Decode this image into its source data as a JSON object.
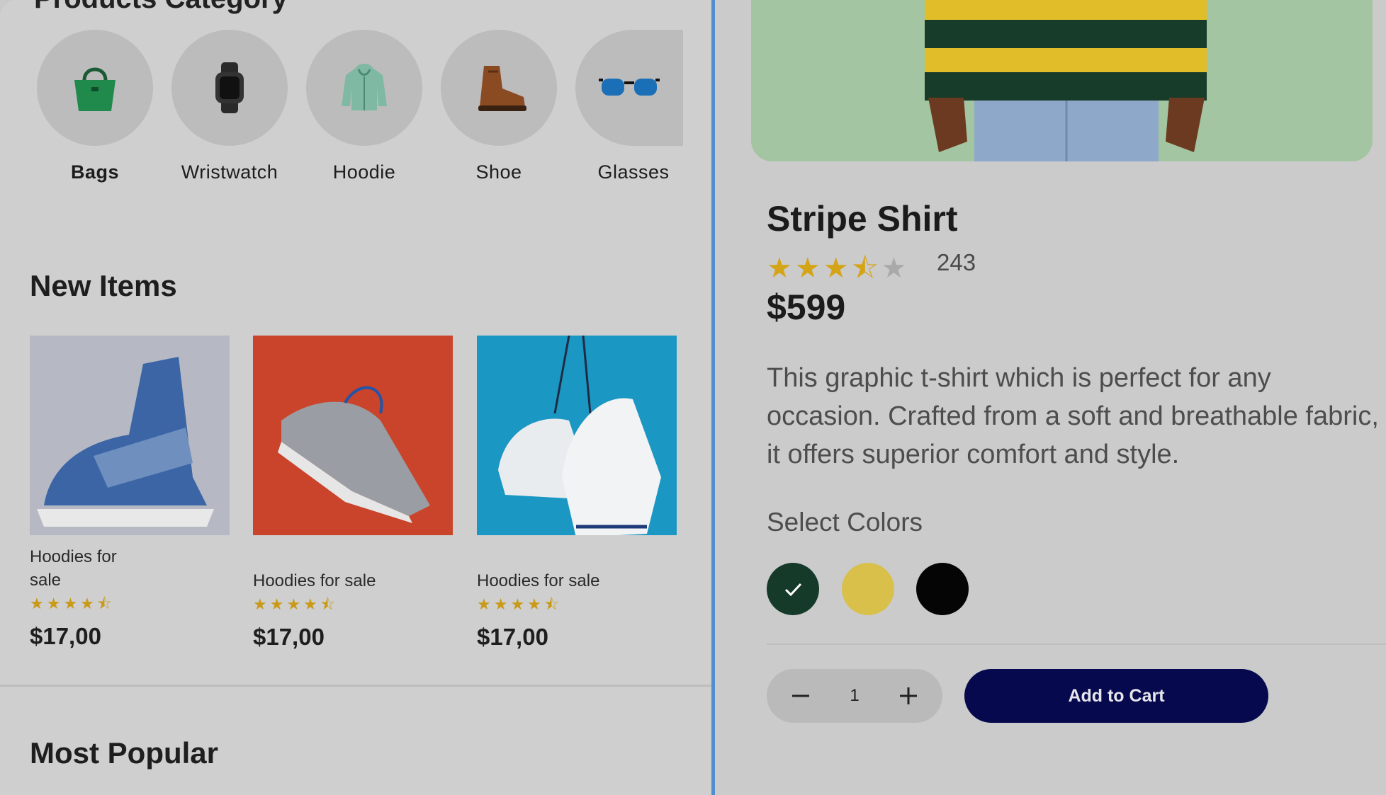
{
  "left": {
    "category_title": "Products Category",
    "categories": [
      {
        "label": "Bags",
        "icon": "handbag-icon"
      },
      {
        "label": "Wristwatch",
        "icon": "smartwatch-icon"
      },
      {
        "label": "Hoodie",
        "icon": "hoodie-icon"
      },
      {
        "label": "Shoe",
        "icon": "boot-icon"
      },
      {
        "label": "Glasses",
        "icon": "sunglasses-icon"
      }
    ],
    "new_items_title": "New Items",
    "new_items": [
      {
        "title": "Hoodies for sale",
        "price": "$17,00",
        "rating": 4.5
      },
      {
        "title": "Hoodies for sale",
        "price": "$17,00",
        "rating": 4.5
      },
      {
        "title": "Hoodies for sale",
        "price": "$17,00",
        "rating": 4.5
      }
    ],
    "most_popular_title": "Most Popular"
  },
  "product": {
    "title": "Stripe Shirt",
    "rating": 3.5,
    "review_count": "243",
    "price": "$599",
    "description": "This graphic t-shirt which is perfect for any occasion. Crafted from a soft and breathable fabric, it offers superior comfort and style.",
    "colors_label": "Select Colors",
    "colors": [
      "#163a2a",
      "#d8c04a",
      "#050505"
    ],
    "selected_color_index": 0,
    "quantity": "1",
    "add_to_cart_label": "Add to Cart"
  },
  "colors": {
    "accent_dark": "#06094e",
    "star": "#d5a416",
    "hero_bg": "#a4c5a1",
    "divider": "#4f8fcf"
  }
}
